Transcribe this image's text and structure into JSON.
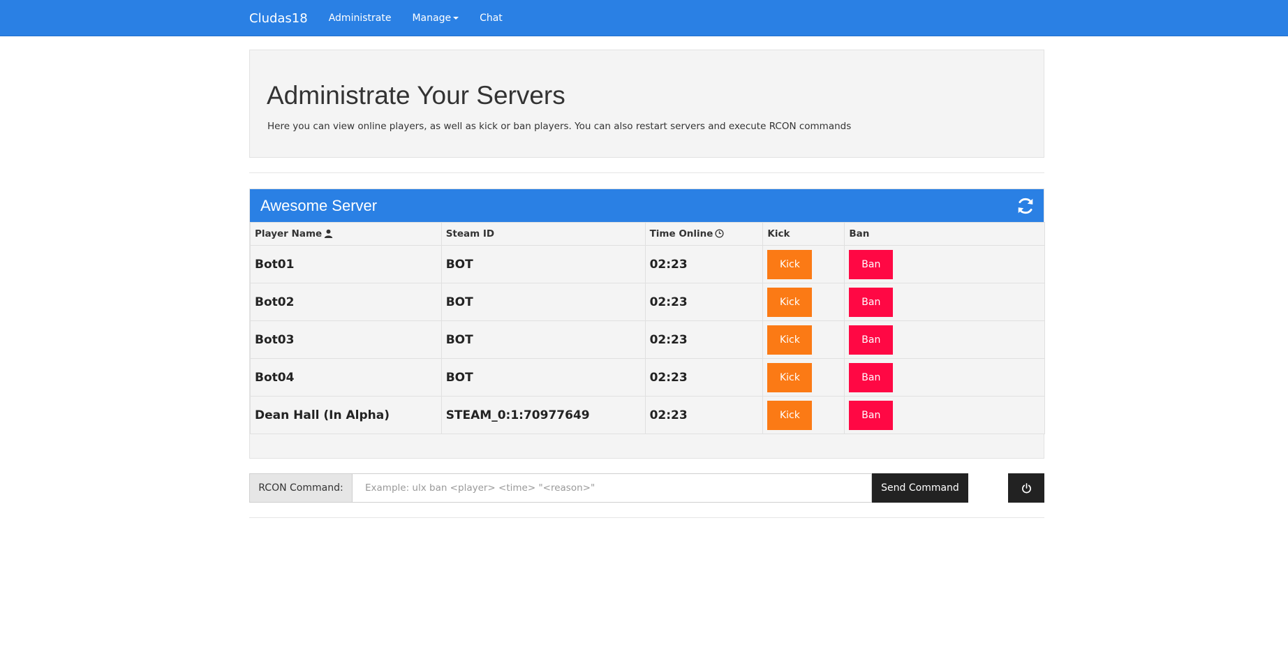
{
  "navbar": {
    "brand": "Cludas18",
    "links": [
      {
        "label": "Administrate"
      },
      {
        "label": "Manage",
        "has_caret": true
      },
      {
        "label": "Chat"
      }
    ],
    "color": "#2a80e4"
  },
  "jumbotron": {
    "title": "Administrate Your Servers",
    "description": "Here you can view online players, as well as kick or ban players. You can also restart servers and execute RCON commands"
  },
  "server_panel": {
    "title": "Awesome Server",
    "refresh_icon": "refresh-icon",
    "columns": [
      "Player Name",
      "Steam ID",
      "Time Online",
      "Kick",
      "Ban"
    ],
    "column_icons": [
      "user-icon",
      "",
      "clock-icon",
      "",
      ""
    ],
    "kick_label": "Kick",
    "ban_label": "Ban",
    "kick_color": "#fb7a15",
    "ban_color": "#ff0844",
    "rows": [
      {
        "name": "Bot01",
        "steam_id": "BOT",
        "time": "02:23"
      },
      {
        "name": "Bot02",
        "steam_id": "BOT",
        "time": "02:23"
      },
      {
        "name": "Bot03",
        "steam_id": "BOT",
        "time": "02:23"
      },
      {
        "name": "Bot04",
        "steam_id": "BOT",
        "time": "02:23"
      },
      {
        "name": "Dean Hall (In Alpha)",
        "steam_id": "STEAM_0:1:70977649",
        "time": "02:23"
      }
    ]
  },
  "rcon": {
    "label": "RCON Command:",
    "value": "",
    "placeholder": "Example: ulx ban <player> <time> \"<reason>\"",
    "send_label": "Send Command",
    "power_icon": "power-icon"
  }
}
